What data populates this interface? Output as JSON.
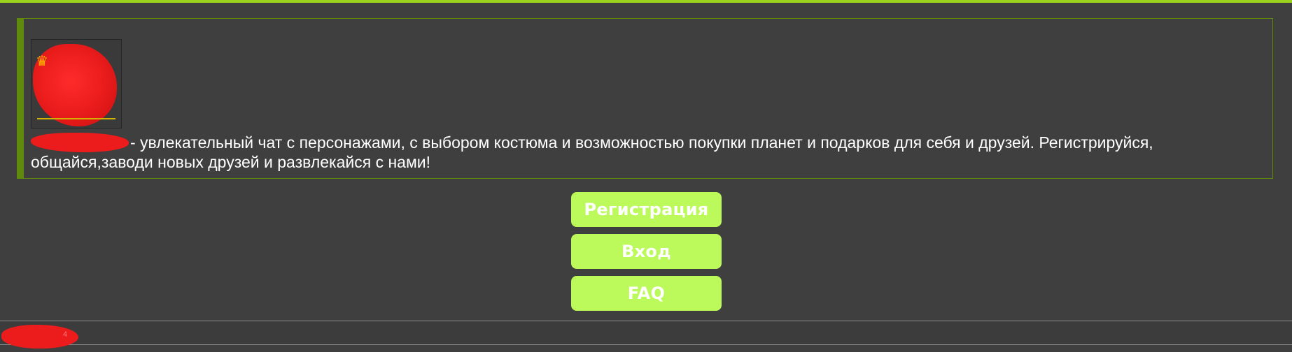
{
  "intro": {
    "description": "- увлекательный чат с персонажами, с выбором костюма и возможностью покупки планет и подарков для себя и друзей. Регистрируйся, общайся,заводи новых друзей и развлекайся с нами!"
  },
  "logo": {
    "icon": "crown-icon"
  },
  "buttons": {
    "register": "Регистрация",
    "login": "Вход",
    "faq": "FAQ"
  },
  "footer": {
    "text": "4"
  },
  "colors": {
    "accent": "#9bd21e",
    "button_bg": "#bbfa5a",
    "background": "#3f3f3f",
    "border": "#5f8a0c"
  }
}
